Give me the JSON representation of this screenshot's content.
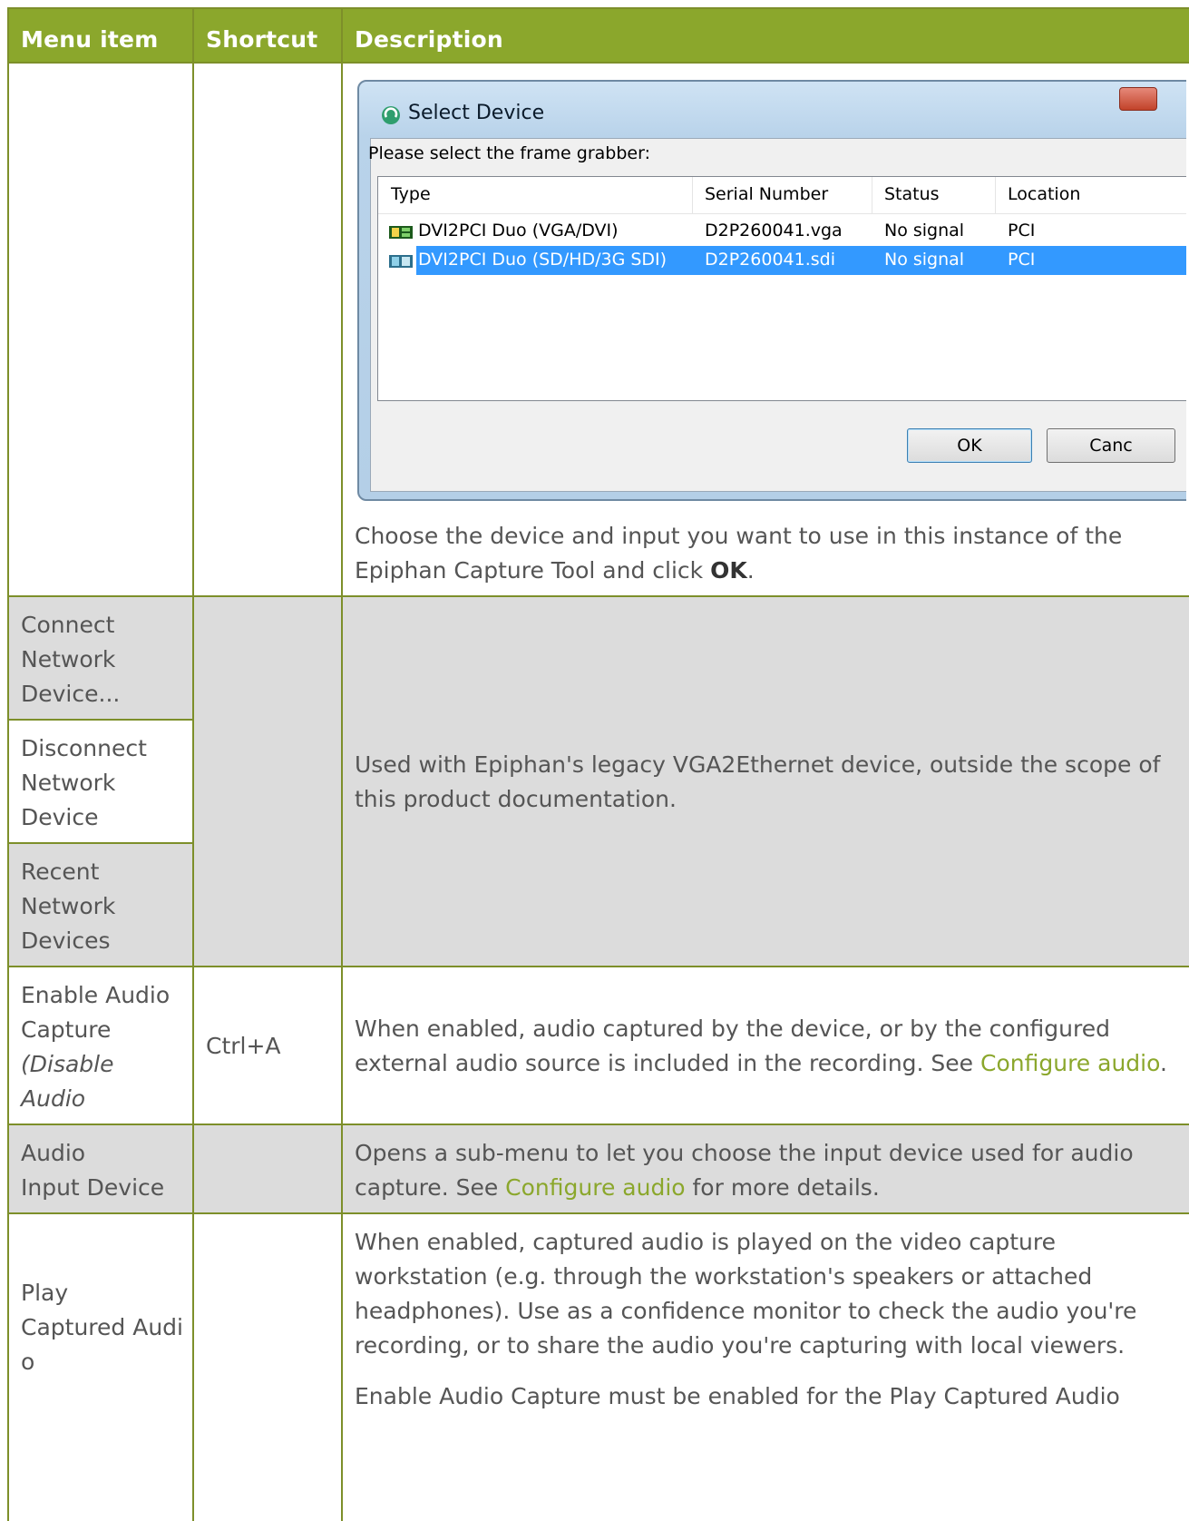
{
  "table": {
    "headers": {
      "menu_item": "Menu item",
      "shortcut": "Shortcut",
      "description": "Description"
    },
    "rows": [
      {
        "menu_item": "",
        "shortcut": "",
        "description_pre": "Choose the device and input you want to use in this instance of the Epiphan Capture Tool and click ",
        "description_bold": "OK",
        "description_post": "."
      },
      {
        "menu_items": [
          "Connect Network Device...",
          "Disconnect Network Device",
          "Recent Network Devices"
        ],
        "shortcut": "",
        "description": "Used with Epiphan's legacy VGA2Ethernet device, outside the scope of this product documentation."
      },
      {
        "menu_item": "Enable Audio Capture",
        "menu_item_alt": "(Disable Audio Capture)",
        "shortcut": "Ctrl+A",
        "description_pre": "When enabled, audio captured by the device, or by the configured external audio source is included in the recording. See ",
        "description_link": "Configure audio",
        "description_post": "."
      },
      {
        "menu_item_line1": "Audio",
        "menu_item_line2": "Input Device",
        "shortcut": "",
        "description_pre": "Opens a sub-menu to let you choose the input device used for audio capture. See ",
        "description_link": "Configure audio",
        "description_post": " for more details."
      },
      {
        "menu_item_line1": "Play",
        "menu_item_line2": "Captured Audi",
        "menu_item_line3": "o",
        "shortcut": "",
        "description_p1": "When enabled, captured audio is played on the video capture workstation (e.g. through the workstation's speakers or attached headphones). Use as a confidence monitor to check the audio you're recording, or to share the audio you're capturing with local viewers.",
        "description_p2": "Enable Audio Capture must be enabled for the Play Captured Audio"
      }
    ]
  },
  "dialog": {
    "title": "Select Device",
    "prompt": "Please select the frame grabber:",
    "columns": [
      "Type",
      "Serial Number",
      "Status",
      "Location"
    ],
    "devices": [
      {
        "type": "DVI2PCI Duo (VGA/DVI)",
        "serial": "D2P260041.vga",
        "status": "No signal",
        "location": "PCI",
        "selected": false
      },
      {
        "type": "DVI2PCI Duo (SD/HD/3G SDI)",
        "serial": "D2P260041.sdi",
        "status": "No signal",
        "location": "PCI",
        "selected": true
      }
    ],
    "ok_label": "OK",
    "cancel_label": "Canc",
    "icons": [
      "app-logo-icon",
      "close-icon",
      "vga-card-icon",
      "sdi-card-icon"
    ]
  },
  "colors": {
    "header_bg": "#8ba72c",
    "border": "#7d8f2a",
    "gray_row": "#dcdcdc",
    "link": "#8ba72c",
    "selection": "#3399ff"
  }
}
